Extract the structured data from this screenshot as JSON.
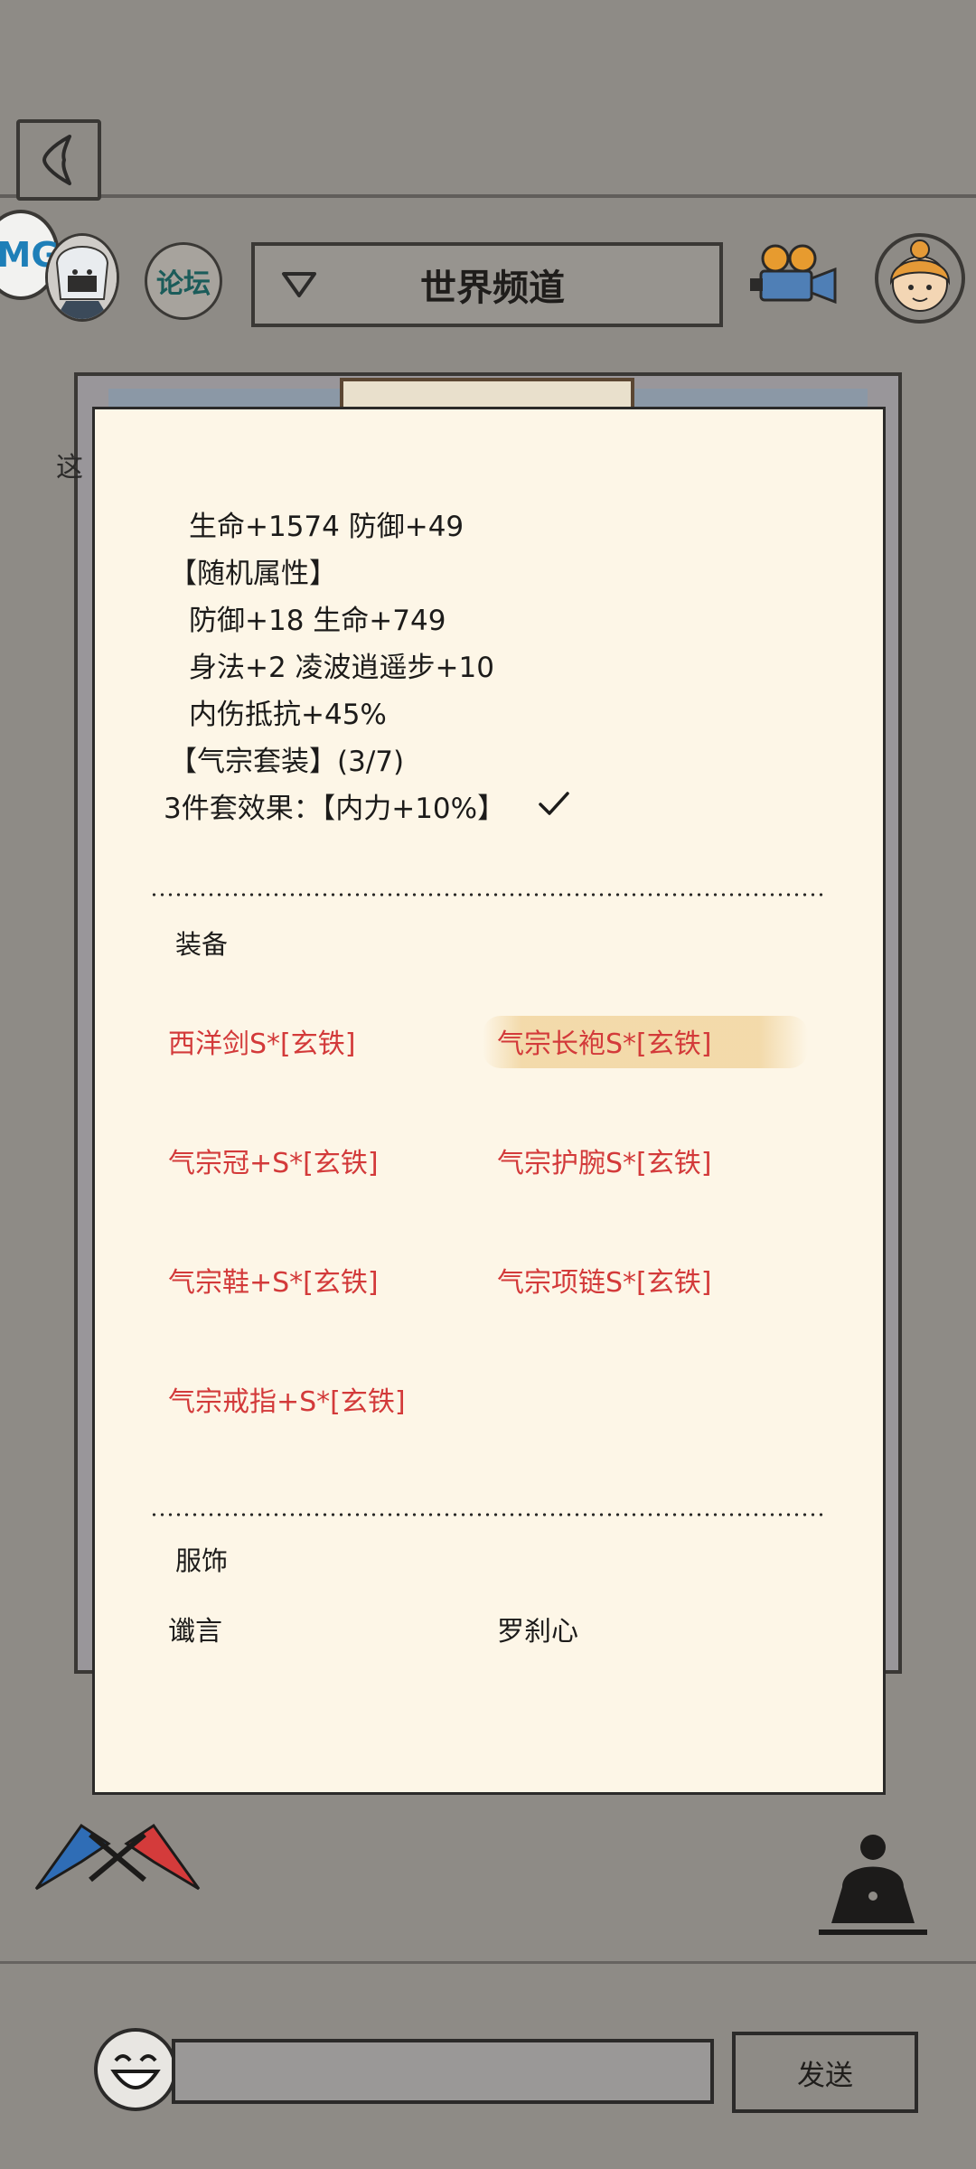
{
  "header": {
    "channel_label": "世界频道",
    "forum_label": "论坛",
    "app_badge_text": "MG"
  },
  "background": {
    "side_text": "这"
  },
  "modal": {
    "attributes": [
      "生命+1574 防御+49",
      "【随机属性】",
      "防御+18 生命+749",
      "身法+2 凌波逍遥步+10",
      "内伤抵抗+45%",
      "【气宗套装】(3/7)",
      "3件套效果：【内力+10%】"
    ],
    "set_effect_complete": true,
    "equipment_label": "装备",
    "equipment": [
      "西洋剑S*[玄铁]",
      "气宗长袍S*[玄铁]",
      "气宗冠+S*[玄铁]",
      "气宗护腕S*[玄铁]",
      "气宗鞋+S*[玄铁]",
      "气宗项链S*[玄铁]",
      "气宗戒指+S*[玄铁]"
    ],
    "costume_label": "服饰",
    "costumes": [
      "谶言",
      "罗刹心"
    ]
  },
  "chat": {
    "input_value": "",
    "send_label": "发送"
  },
  "colors": {
    "equipment_red": "#d33a3a",
    "modal_bg": "#fdf6e7",
    "page_bg": "#8e8b86"
  }
}
